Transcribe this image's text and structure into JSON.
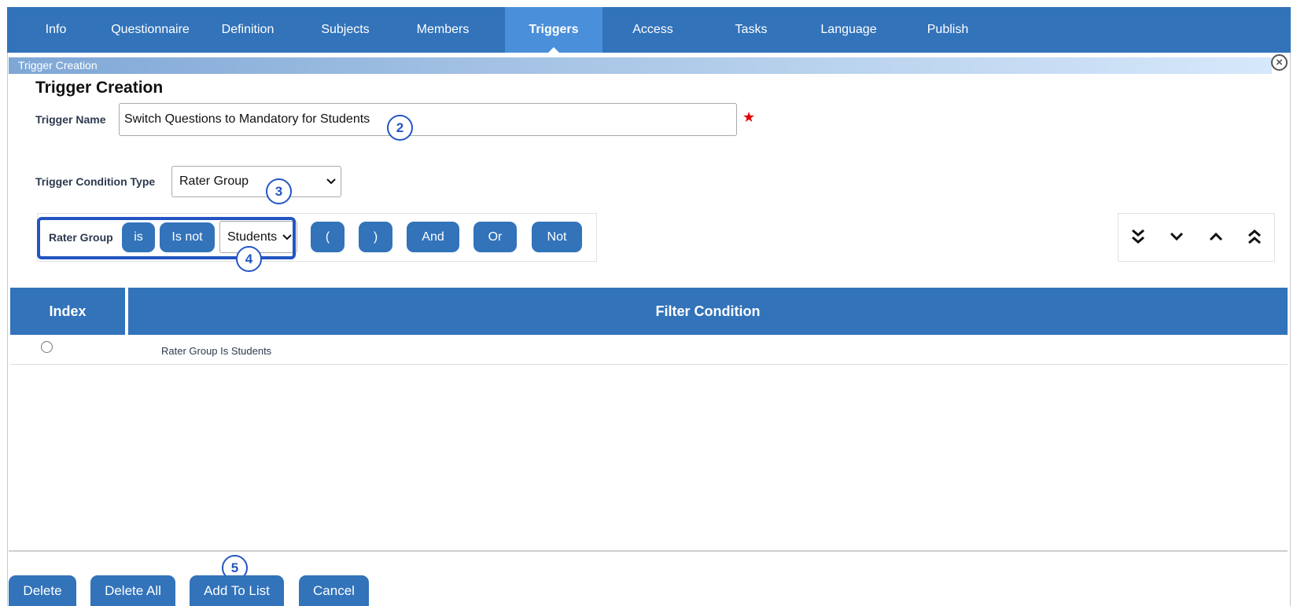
{
  "nav": {
    "tabs": [
      {
        "label": "Info"
      },
      {
        "label": "Questionnaire"
      },
      {
        "label": "Definition"
      },
      {
        "label": "Subjects"
      },
      {
        "label": "Members"
      },
      {
        "label": "Triggers"
      },
      {
        "label": "Access"
      },
      {
        "label": "Tasks"
      },
      {
        "label": "Language"
      },
      {
        "label": "Publish"
      }
    ],
    "active_tab": "Triggers"
  },
  "panel_header": "Trigger Creation",
  "page_title": "Trigger Creation",
  "form": {
    "trigger_name_label": "Trigger Name",
    "trigger_name_value": "Switch Questions to Mandatory for Students",
    "required_mark": "★",
    "condition_type_label": "Trigger Condition Type",
    "condition_type_value": "Rater Group"
  },
  "builder": {
    "field_label": "Rater Group",
    "is_label": "is",
    "is_not_label": "Is not",
    "value_select": "Students",
    "open_paren": "(",
    "close_paren": ")",
    "and_label": "And",
    "or_label": "Or",
    "not_label": "Not"
  },
  "badges": [
    "2",
    "3",
    "4",
    "5"
  ],
  "table": {
    "headers": [
      "Index",
      "Filter Condition"
    ],
    "rows": [
      {
        "condition": "Rater Group Is Students"
      }
    ]
  },
  "actions": {
    "delete": "Delete",
    "delete_all": "Delete All",
    "add_to_list": "Add To List",
    "cancel": "Cancel"
  },
  "colors": {
    "nav_bg": "#3273ba",
    "nav_active": "#4a8fda",
    "button": "#3273ba",
    "badge": "#2355c4",
    "required": "#e00000"
  },
  "icons": {
    "close": "close-circle-icon",
    "move_bottom": "double-chevron-down-icon",
    "move_down": "chevron-down-icon",
    "move_up": "chevron-up-icon",
    "move_top": "double-chevron-up-icon"
  }
}
